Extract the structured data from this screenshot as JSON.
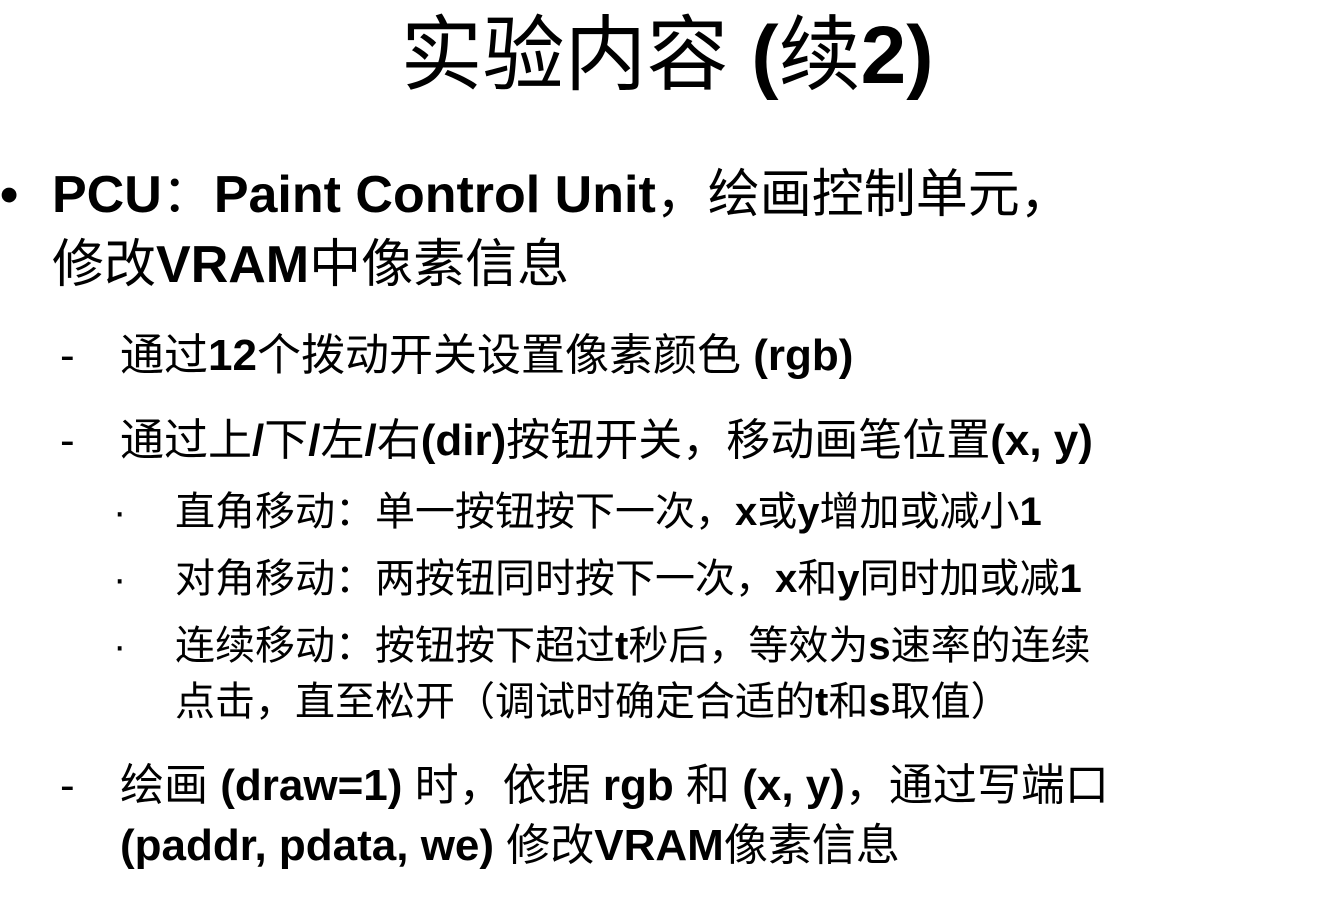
{
  "title": [
    {
      "t": "实验内容 ",
      "b": false
    },
    {
      "t": "(",
      "b": true
    },
    {
      "t": "续",
      "b": false
    },
    {
      "t": "2)",
      "b": true
    }
  ],
  "bullet_marks": {
    "main": "•",
    "dash": "-",
    "dot": "·"
  },
  "lines": [
    {
      "level": 1,
      "mark": "main",
      "segs": [
        {
          "t": "PCU",
          "b": true
        },
        {
          "t": "：",
          "b": false
        },
        {
          "t": "Paint Control Unit",
          "b": true
        },
        {
          "t": "，绘画控制单元，",
          "b": false
        }
      ]
    },
    {
      "level": 1,
      "mark": "",
      "segs": [
        {
          "t": "修改",
          "b": false
        },
        {
          "t": "VRAM",
          "b": true
        },
        {
          "t": "中像素信息",
          "b": false
        }
      ]
    },
    {
      "level": 2,
      "mark": "dash",
      "segs": [
        {
          "t": "通过",
          "b": false
        },
        {
          "t": "12",
          "b": true
        },
        {
          "t": "个拨动开关设置像素颜色 ",
          "b": false
        },
        {
          "t": "(rgb)",
          "b": true
        }
      ]
    },
    {
      "level": 2,
      "mark": "dash",
      "segs": [
        {
          "t": "通过上",
          "b": false
        },
        {
          "t": "/",
          "b": true
        },
        {
          "t": "下",
          "b": false
        },
        {
          "t": "/",
          "b": true
        },
        {
          "t": "左",
          "b": false
        },
        {
          "t": "/",
          "b": true
        },
        {
          "t": "右",
          "b": false
        },
        {
          "t": "(dir)",
          "b": true
        },
        {
          "t": "按钮开关，移动画笔位置",
          "b": false
        },
        {
          "t": "(x, y)",
          "b": true
        }
      ]
    },
    {
      "level": 3,
      "mark": "dot",
      "segs": [
        {
          "t": "直角移动：单一按钮按下一次，",
          "b": false
        },
        {
          "t": "x",
          "b": true
        },
        {
          "t": "或",
          "b": false
        },
        {
          "t": "y",
          "b": true
        },
        {
          "t": "增加或减小",
          "b": false
        },
        {
          "t": "1",
          "b": true
        }
      ]
    },
    {
      "level": 3,
      "mark": "dot",
      "segs": [
        {
          "t": "对角移动：两按钮同时按下一次，",
          "b": false
        },
        {
          "t": "x",
          "b": true
        },
        {
          "t": "和",
          "b": false
        },
        {
          "t": "y",
          "b": true
        },
        {
          "t": "同时加或减",
          "b": false
        },
        {
          "t": "1",
          "b": true
        }
      ]
    },
    {
      "level": 3,
      "mark": "dot",
      "segs": [
        {
          "t": "连续移动：按钮按下超过",
          "b": false
        },
        {
          "t": "t",
          "b": true
        },
        {
          "t": "秒后，等效为",
          "b": false
        },
        {
          "t": "s",
          "b": true
        },
        {
          "t": "速率的连续",
          "b": false
        }
      ]
    },
    {
      "level": 3,
      "mark": "",
      "segs": [
        {
          "t": "点击，直至松开（调试时确定合适的",
          "b": false
        },
        {
          "t": "t",
          "b": true
        },
        {
          "t": "和",
          "b": false
        },
        {
          "t": "s",
          "b": true
        },
        {
          "t": "取值）",
          "b": false
        }
      ]
    },
    {
      "level": 2,
      "mark": "dash",
      "segs": [
        {
          "t": "绘画 ",
          "b": false
        },
        {
          "t": "(draw=1)",
          "b": true
        },
        {
          "t": " 时，依据 ",
          "b": false
        },
        {
          "t": "rgb",
          "b": true
        },
        {
          "t": " 和 ",
          "b": false
        },
        {
          "t": "(x, y)",
          "b": true
        },
        {
          "t": "，通过写端口",
          "b": false
        }
      ]
    },
    {
      "level": 2,
      "mark": "",
      "segs": [
        {
          "t": "(paddr, pdata, we)",
          "b": true
        },
        {
          "t": " 修改",
          "b": false
        },
        {
          "t": "VRAM",
          "b": true
        },
        {
          "t": "像素信息",
          "b": false
        }
      ]
    }
  ]
}
